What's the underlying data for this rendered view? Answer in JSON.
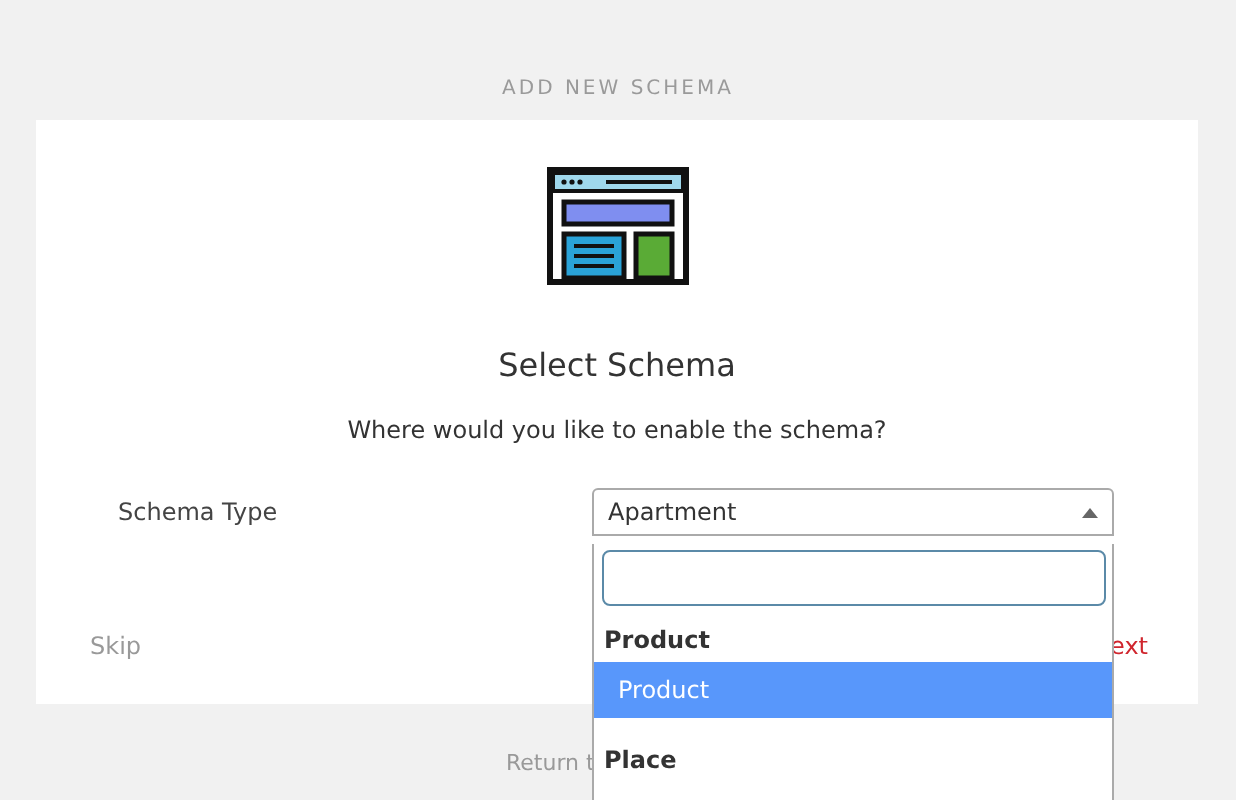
{
  "page_title": "ADD NEW SCHEMA",
  "card": {
    "heading": "Select Schema",
    "subtitle": "Where would you like to enable the schema?",
    "field": {
      "label": "Schema Type",
      "value": "Apartment",
      "expanded": true
    },
    "skip": "Skip",
    "next_partial": "ext"
  },
  "dropdown": {
    "items": [
      {
        "kind": "group",
        "label": "Product"
      },
      {
        "kind": "option",
        "label": "Product",
        "selected": true
      },
      {
        "kind": "group",
        "label": "Place"
      }
    ]
  },
  "return_link_partial": "Return t"
}
